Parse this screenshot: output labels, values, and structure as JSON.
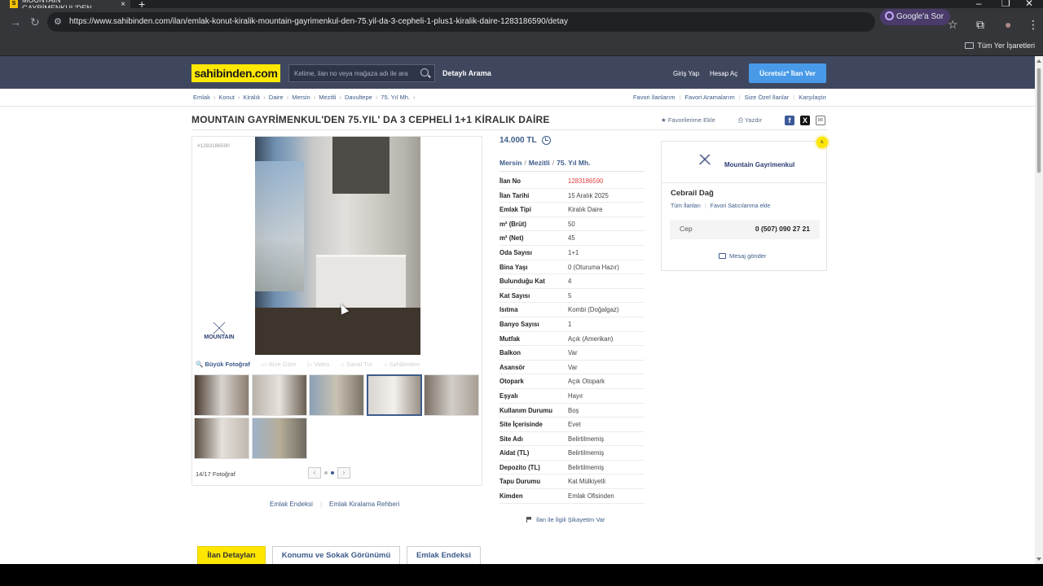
{
  "browser": {
    "tab_title": "MOUNTAIN GAYRİMENKUL'DEN",
    "tab_favicon": "S",
    "url": "https://www.sahibinden.com/ilan/emlak-konut-kiralik-mountain-gayrimenkul-den-75.yil-da-3-cepheli-1-plus1-kiralik-daire-1283186590/detay",
    "google_sor": "Google'a Sor",
    "all_bookmarks": "Tüm Yer İşaretleri"
  },
  "header": {
    "logo": "sahibinden.com",
    "search_placeholder": "Kelime, ilan no veya mağaza adı ile ara",
    "detailed_search": "Detaylı Arama",
    "login": "Giriş Yap",
    "register": "Hesap Aç",
    "post_ad": "Ücretsiz* İlan Ver",
    "accent": "#ffe800"
  },
  "breadcrumbs": [
    "Emlak",
    "Konut",
    "Kiralık",
    "Daire",
    "Mersin",
    "Mezitli",
    "Davultepe",
    "75. Yıl Mh."
  ],
  "top_links": [
    "Favori İlanlarım",
    "Favori Aramalarım",
    "Size Özel İlanlar",
    "Karşılaştır"
  ],
  "listing": {
    "title": "MOUNTAIN GAYRİMENKUL'DEN 75.YIL' DA 3 CEPHELİ 1+1 KİRALIK DAİRE",
    "add_favorite": "Favorilerime Ekle",
    "print": "Yazdır",
    "ilan_no_small": "#1283186590",
    "price": "14.000 TL",
    "location": [
      "Mersin",
      "Mezitli",
      "75. Yıl Mh."
    ],
    "details": [
      {
        "k": "İlan No",
        "v": "1283186590"
      },
      {
        "k": "İlan Tarihi",
        "v": "15 Aralık 2025"
      },
      {
        "k": "Emlak Tipi",
        "v": "Kiralık Daire"
      },
      {
        "k": "m² (Brüt)",
        "v": "50"
      },
      {
        "k": "m² (Net)",
        "v": "45"
      },
      {
        "k": "Oda Sayısı",
        "v": "1+1"
      },
      {
        "k": "Bina Yaşı",
        "v": "0 (Oturuma Hazır)"
      },
      {
        "k": "Bulunduğu Kat",
        "v": "4"
      },
      {
        "k": "Kat Sayısı",
        "v": "5"
      },
      {
        "k": "Isıtma",
        "v": "Kombi (Doğalgaz)"
      },
      {
        "k": "Banyo Sayısı",
        "v": "1"
      },
      {
        "k": "Mutfak",
        "v": "Açık (Amerikan)"
      },
      {
        "k": "Balkon",
        "v": "Var"
      },
      {
        "k": "Asansör",
        "v": "Var"
      },
      {
        "k": "Otopark",
        "v": "Açık Otopark"
      },
      {
        "k": "Eşyalı",
        "v": "Hayır"
      },
      {
        "k": "Kullanım Durumu",
        "v": "Boş"
      },
      {
        "k": "Site İçerisinde",
        "v": "Evet"
      },
      {
        "k": "Site Adı",
        "v": "Belirtilmemiş"
      },
      {
        "k": "Aidat (TL)",
        "v": "Belirtilmemiş"
      },
      {
        "k": "Depozito (TL)",
        "v": "Belirtilmemiş"
      },
      {
        "k": "Tapu Durumu",
        "v": "Kat Mülkiyetli"
      },
      {
        "k": "Kimden",
        "v": "Emlak Ofisinden"
      }
    ],
    "complaint": "İlan ile İlgili Şikayetim Var"
  },
  "gallery": {
    "watermark": "MOUNTAIN",
    "tabs": {
      "big_photo": "Büyük Fotoğraf",
      "bize_gore": "Bize Göre",
      "video": "Video",
      "sanal_tur": "Sanal Tur",
      "sahibinden": "Sahibinden"
    },
    "photo_count": "14/17 Fotoğraf",
    "selected_thumb": 4,
    "thumb_colors": [
      [
        "#4a3a30",
        "#d8d4cf",
        "#8c7d70"
      ],
      [
        "#b9b3aa",
        "#e6e2dc",
        "#6a5e52"
      ],
      [
        "#8aa0b6",
        "#c9c2b2",
        "#7c7468"
      ],
      [
        "#d9d6d1",
        "#f2f0ec",
        "#9a9086"
      ],
      [
        "#7a6e63",
        "#d2cec8",
        "#a89f94"
      ],
      [
        "#5a4d42",
        "#e4e0da",
        "#c0b8ae"
      ],
      [
        "#9db2c8",
        "#b7ad98",
        "#6e6a62"
      ]
    ]
  },
  "under_links": [
    "Emlak Endeksi",
    "Emlak Kiralama Rehberi"
  ],
  "seller": {
    "store_name": "Mountain Gayrimenkul",
    "agent": "Cebrail Dağ",
    "all_ads": "Tüm İlanları",
    "add_fav_seller": "Favori Satıcılarıma ekle",
    "phone_label": "Cep",
    "phone": "0 (507) 090 27 21",
    "message": "Mesaj gönder"
  },
  "bottom_tabs": [
    "İlan Detayları",
    "Konumu ve Sokak Görünümü",
    "Emlak Endeksi"
  ]
}
